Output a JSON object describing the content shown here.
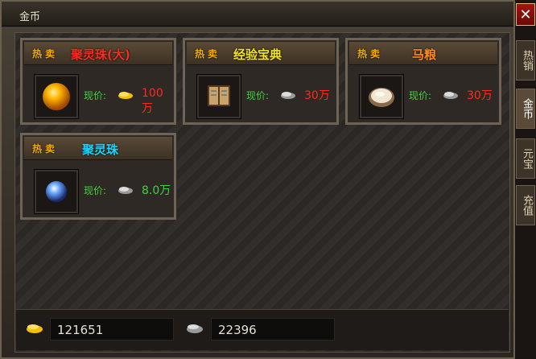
{
  "window": {
    "title": "金币"
  },
  "close_label": "✕",
  "side_tabs": [
    "热销",
    "金币",
    "元宝",
    "充值"
  ],
  "price_label": "现价:",
  "hot_label": "热卖",
  "items": [
    {
      "name": "聚灵珠(大)",
      "name_color": "#ff2a1f",
      "price": "100万",
      "price_color": "#ff2a1f",
      "currency": "gold",
      "icon": "golden-orb-icon"
    },
    {
      "name": "经验宝典",
      "name_color": "#f4e31a",
      "price": "30万",
      "price_color": "#ff2a1f",
      "currency": "silver",
      "icon": "book-icon"
    },
    {
      "name": "马粮",
      "name_color": "#ff8a1a",
      "price": "30万",
      "price_color": "#ff2a1f",
      "currency": "silver",
      "icon": "rice-bowl-icon"
    },
    {
      "name": "聚灵珠",
      "name_color": "#19d6ff",
      "price": "8.0万",
      "price_color": "#3fd23f",
      "currency": "silver",
      "icon": "blue-orb-icon"
    }
  ],
  "balances": {
    "gold": "121651",
    "silver": "22396"
  },
  "colors": {
    "gold_coin": "#f2c200",
    "silver_coin": "#b8b8b8"
  }
}
